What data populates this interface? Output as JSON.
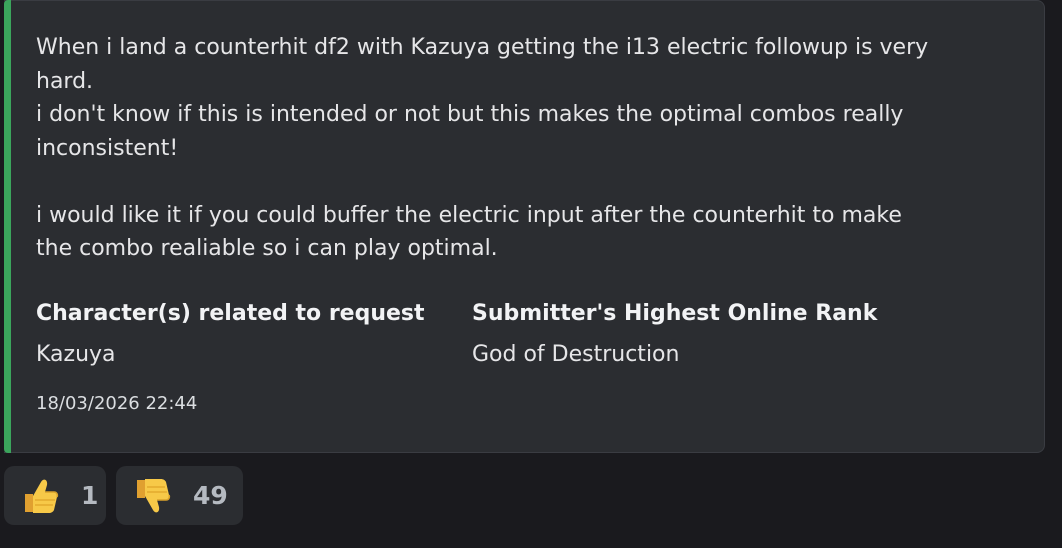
{
  "embed": {
    "accent_color": "#3ba55c",
    "description": "When i land a counterhit df2 with Kazuya getting the i13 electric followup is very\nhard.\ni don't know if this is intended or not but this makes the optimal combos really\ninconsistent!\n\ni would like it if you could buffer the electric input after the counterhit to make\nthe combo realiable so i can play optimal.",
    "fields": [
      {
        "name": "Character(s) related to request",
        "value": "Kazuya"
      },
      {
        "name": "Submitter's Highest Online Rank",
        "value": "God of Destruction"
      }
    ],
    "timestamp": "18/03/2026 22:44"
  },
  "reactions": [
    {
      "emoji": "thumbs-up-icon",
      "count": "1"
    },
    {
      "emoji": "thumbs-down-icon",
      "count": "49"
    }
  ]
}
